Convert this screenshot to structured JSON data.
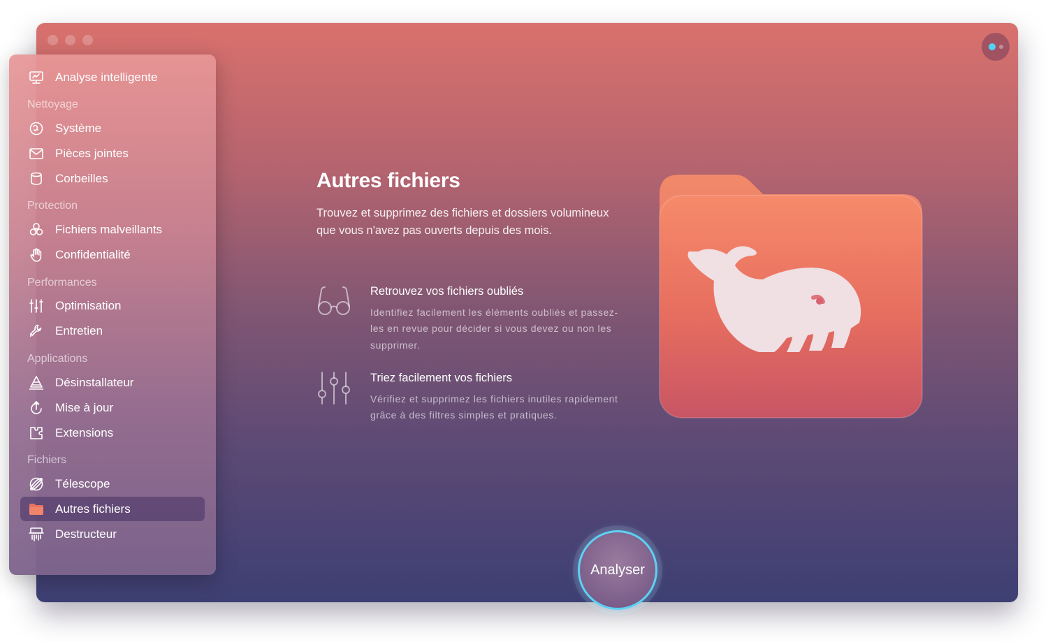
{
  "window": {
    "traffic_lights": [
      "close",
      "minimize",
      "zoom"
    ]
  },
  "sidebar": {
    "top_item": {
      "label": "Analyse intelligente",
      "icon": "monitor-icon"
    },
    "sections": [
      {
        "label": "Nettoyage",
        "items": [
          {
            "label": "Système",
            "icon": "system-junk-icon"
          },
          {
            "label": "Pièces jointes",
            "icon": "envelope-icon"
          },
          {
            "label": "Corbeilles",
            "icon": "trash-bin-icon"
          }
        ]
      },
      {
        "label": "Protection",
        "items": [
          {
            "label": "Fichiers malveillants",
            "icon": "biohazard-icon"
          },
          {
            "label": "Confidentialité",
            "icon": "hand-icon"
          }
        ]
      },
      {
        "label": "Performances",
        "items": [
          {
            "label": "Optimisation",
            "icon": "sliders-icon"
          },
          {
            "label": "Entretien",
            "icon": "wrench-icon"
          }
        ]
      },
      {
        "label": "Applications",
        "items": [
          {
            "label": "Désinstallateur",
            "icon": "uninstaller-icon"
          },
          {
            "label": "Mise à jour",
            "icon": "updater-icon"
          },
          {
            "label": "Extensions",
            "icon": "extensions-icon"
          }
        ]
      },
      {
        "label": "Fichiers",
        "items": [
          {
            "label": "Télescope",
            "icon": "space-lens-icon"
          },
          {
            "label": "Autres fichiers",
            "icon": "folder-icon",
            "active": true
          },
          {
            "label": "Destructeur",
            "icon": "shredder-icon"
          }
        ]
      }
    ]
  },
  "main": {
    "title": "Autres fichiers",
    "description": "Trouvez et supprimez des fichiers et dossiers volumineux que vous n'avez pas ouverts depuis des mois.",
    "features": [
      {
        "title": "Retrouvez vos fichiers oubliés",
        "description": "Identifiez facilement les éléments oubliés et passez-les en revue pour décider si vous devez ou non les supprimer.",
        "icon": "glasses-icon"
      },
      {
        "title": "Triez facilement vos fichiers",
        "description": "Vérifiez et supprimez les fichiers inutiles rapidement grâce à des filtres simples et pratiques.",
        "icon": "filter-sliders-icon"
      }
    ],
    "hero_icon": "whale-folder-icon",
    "scan_button": "Analyser"
  },
  "colors": {
    "accent_ring": "#5fd0f3",
    "folder": "#e8735e",
    "assistant_dot": "#4fd4f5"
  }
}
